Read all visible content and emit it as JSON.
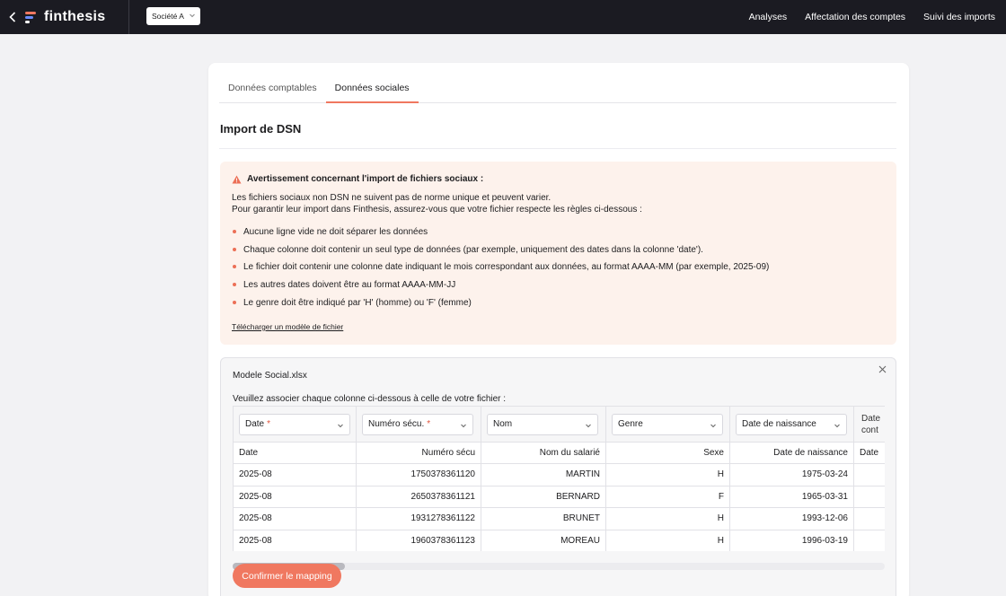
{
  "header": {
    "brand": "finthesis",
    "company_select": "Société A",
    "nav": [
      "Analyses",
      "Affectation des comptes",
      "Suivi des imports"
    ]
  },
  "tabs": [
    {
      "label": "Données comptables",
      "active": false
    },
    {
      "label": "Données sociales",
      "active": true
    }
  ],
  "section_title": "Import de DSN",
  "warning": {
    "title": "Avertissement concernant l'import de fichiers sociaux :",
    "intro_1": "Les fichiers sociaux non DSN ne suivent pas de norme unique et peuvent varier.",
    "intro_2": "Pour garantir leur import dans Finthesis, assurez-vous que votre fichier respecte les règles ci-dessous :",
    "rules": [
      "Aucune ligne vide ne doit séparer les données",
      "Chaque colonne doit contenir un seul type de données (par exemple, uniquement des dates dans la colonne 'date').",
      "Le fichier doit contenir une colonne date indiquant le mois correspondant aux données, au format AAAA-MM (par exemple, 2025-09)",
      "Les autres dates doivent être au format AAAA-MM-JJ",
      "Le genre doit être indiqué par 'H' (homme) ou 'F' (femme)"
    ],
    "download_link": "Télécharger un modèle de fichier"
  },
  "file_panel": {
    "filename": "Modele Social.xlsx",
    "instruction": "Veuillez associer chaque colonne ci-dessous à celle de votre fichier :",
    "mapping_selects": [
      {
        "label": "Date",
        "required": "*"
      },
      {
        "label": "Numéro sécu.",
        "required": "*"
      },
      {
        "label": "Nom",
        "required": ""
      },
      {
        "label": "Genre",
        "required": ""
      },
      {
        "label": "Date de naissance",
        "required": ""
      },
      {
        "label": "Date\ncont",
        "required": ""
      }
    ],
    "columns": [
      "Date",
      "Numéro sécu",
      "Nom du salarié",
      "Sexe",
      "Date de naissance",
      "Date"
    ],
    "rows": [
      [
        "2025-08",
        "1750378361120",
        "MARTIN",
        "H",
        "1975-03-24",
        ""
      ],
      [
        "2025-08",
        "2650378361121",
        "BERNARD",
        "F",
        "1965-03-31",
        ""
      ],
      [
        "2025-08",
        "1931278361122",
        "BRUNET",
        "H",
        "1993-12-06",
        ""
      ],
      [
        "2025-08",
        "1960378361123",
        "MOREAU",
        "H",
        "1996-03-19",
        ""
      ]
    ],
    "confirm_button": "Confirmer le mapping"
  },
  "colors": {
    "accent": "#f07860",
    "topbar": "#1b1b22",
    "warning_bg": "#fdf2ec",
    "logo": [
      "#f07860",
      "#6b8cff",
      "#ffffff"
    ]
  }
}
